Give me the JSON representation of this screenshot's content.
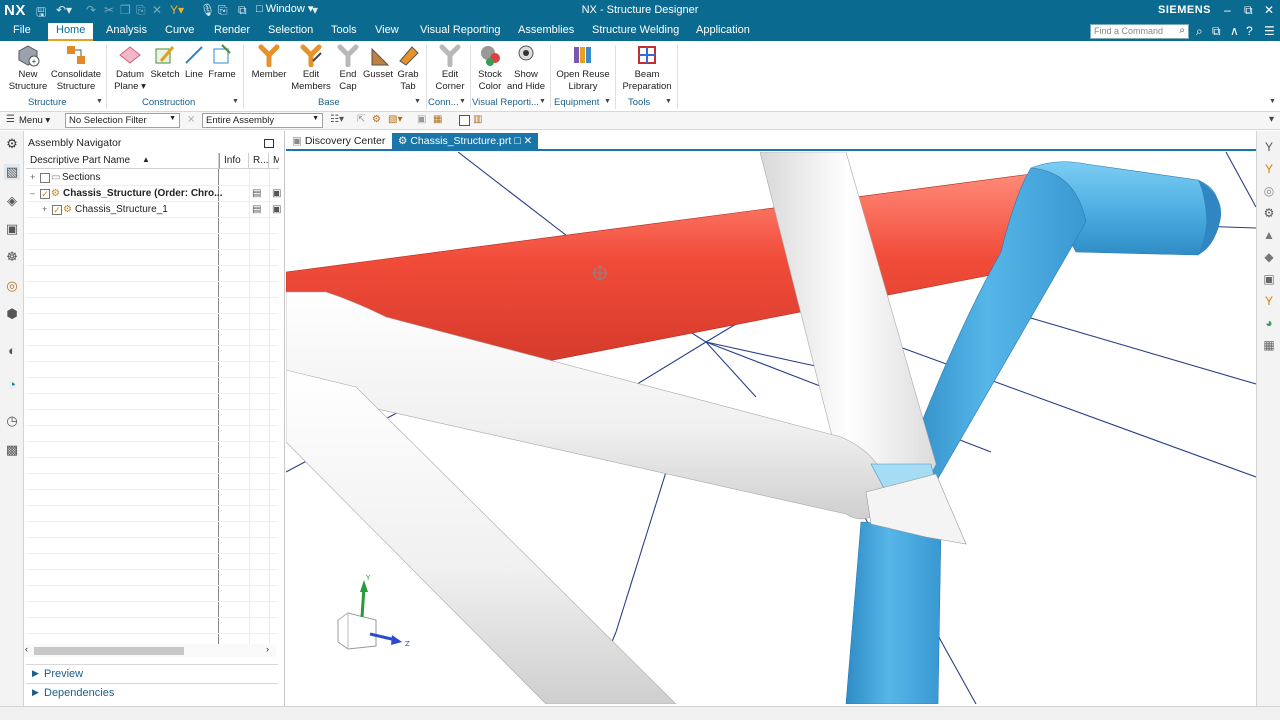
{
  "titlebar": {
    "logo": "NX",
    "window_menu": "Window",
    "title": "NX - Structure Designer",
    "brand": "SIEMENS"
  },
  "menubar": {
    "items": [
      "File",
      "Home",
      "Analysis",
      "Curve",
      "Render",
      "Selection",
      "Tools",
      "View",
      "Visual Reporting",
      "Assemblies",
      "Structure Welding",
      "Application"
    ],
    "active": "Home",
    "find_placeholder": "Find a Command"
  },
  "ribbon": {
    "buttons": [
      {
        "line1": "New",
        "line2": "Structure",
        "icon": "new-structure-icon"
      },
      {
        "line1": "Consolidate",
        "line2": "Structure",
        "icon": "consolidate-structure-icon"
      },
      {
        "line1": "Datum",
        "line2": "Plane ▾",
        "icon": "datum-plane-icon"
      },
      {
        "line1": "Sketch",
        "line2": "",
        "icon": "sketch-icon"
      },
      {
        "line1": "Line",
        "line2": "",
        "icon": "line-icon"
      },
      {
        "line1": "Frame",
        "line2": "",
        "icon": "frame-icon"
      },
      {
        "line1": "Member",
        "line2": "",
        "icon": "member-icon"
      },
      {
        "line1": "Edit",
        "line2": "Members",
        "icon": "edit-members-icon"
      },
      {
        "line1": "End",
        "line2": "Cap",
        "icon": "end-cap-icon"
      },
      {
        "line1": "Gusset",
        "line2": "",
        "icon": "gusset-icon"
      },
      {
        "line1": "Grab",
        "line2": "Tab",
        "icon": "grab-tab-icon"
      },
      {
        "line1": "Edit",
        "line2": "Corner",
        "icon": "edit-corner-icon"
      },
      {
        "line1": "Stock",
        "line2": "Color",
        "icon": "stock-color-icon"
      },
      {
        "line1": "Show",
        "line2": "and Hide",
        "icon": "show-and-hide-icon"
      },
      {
        "line1": "Open Reuse",
        "line2": "Library",
        "icon": "open-reuse-library-icon"
      },
      {
        "line1": "Beam",
        "line2": "Preparation",
        "icon": "beam-preparation-icon"
      }
    ],
    "groups": [
      "Structure",
      "Construction",
      "Base",
      "Conn...",
      "Visual Reporti...",
      "Equipment",
      "Tools"
    ]
  },
  "filterbar": {
    "menu_label": "Menu",
    "selection_filter": "No Selection Filter",
    "scope": "Entire Assembly"
  },
  "navigator": {
    "title": "Assembly Navigator",
    "columns": [
      "Descriptive Part Name",
      "Info",
      "R...",
      "M"
    ],
    "rows": [
      {
        "label": "Sections",
        "bold": false
      },
      {
        "label": "Chassis_Structure (Order: Chro...",
        "bold": true
      },
      {
        "label": "Chassis_Structure_1",
        "bold": false
      }
    ],
    "panels": [
      "Preview",
      "Dependencies"
    ]
  },
  "tabs": {
    "discovery": "Discovery Center",
    "part": "Chassis_Structure.prt"
  },
  "triad": {
    "y": "Y",
    "z": "Z"
  },
  "colors": {
    "titlebar": "#0b6a8f",
    "member_red": "#f04a3a",
    "member_blue": "#4fb0e3",
    "member_white": "#f2f2f2",
    "sketch_line": "#2a3f8a"
  }
}
